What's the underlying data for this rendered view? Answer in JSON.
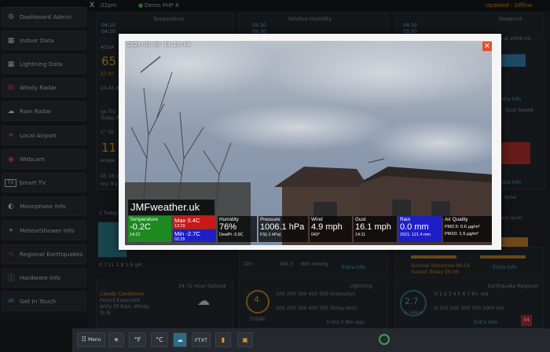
{
  "topbar": {
    "time": ":52pm",
    "station": "Demo PHP 8",
    "updated": "Updated : Offline"
  },
  "sidebar": {
    "items": [
      {
        "label": "Dashboard Admin",
        "icon": "gear-icon"
      },
      {
        "label": "Indoor Data",
        "icon": "indoor-icon"
      },
      {
        "label": "Lightning Data",
        "icon": "lightning-icon"
      },
      {
        "label": "Windy Radar",
        "icon": "windy-icon"
      },
      {
        "label": "Rain Radar",
        "icon": "cloud-icon"
      },
      {
        "label": "Local Airport",
        "icon": "airplane-icon"
      },
      {
        "label": "Webcam",
        "icon": "webcam-icon"
      },
      {
        "label": "Smart TV",
        "icon": "tv-icon"
      },
      {
        "label": "Moonphase Info",
        "icon": "moon-icon"
      },
      {
        "label": "MeteorShower Info",
        "icon": "meteor-icon"
      },
      {
        "label": "Regional Earthquakes",
        "icon": "earthquake-icon"
      },
      {
        "label": "Hardware Info",
        "icon": "info-icon"
      },
      {
        "label": "Get In Touch",
        "icon": "contact-icon"
      }
    ]
  },
  "dashboard": {
    "temperature_title": "Temperature",
    "humidity_title": "Relative Humidity",
    "dewpoint_title": "Dewpoint",
    "temp_rows": [
      "04:10",
      "04:10"
    ],
    "hum_rows": [
      "03:20",
      "09:30"
    ],
    "dew_rows": [
      "04:10",
      "05:50"
    ],
    "dew_note": "m at 2008 mt",
    "gust_title": "Gust Speed",
    "solar_title": "Solar",
    "uv_title": "face (Lux)",
    "extra_info": "Extra Info",
    "big_left": "65",
    "big_left2": "11",
    "side_labels": [
      "ACGA",
      "27.0°",
      "24.65.8",
      "ge Tra",
      "Today R",
      "C° SE",
      "erage",
      "05 16:24",
      "ory Tra",
      "2 Today R"
    ],
    "bottom_left_val": "0.7 11 1.8 1.9 iph",
    "pressure_scale": [
      "720",
      "780.3",
      "800 mmHg"
    ],
    "sunrise": "Sunrise Tomorrow 06:54",
    "sunset": "Sunset Today 06:06",
    "outlook_title": "24-72 Hour Outlook",
    "outlook_text": [
      "Cloudy Conditions.",
      "Period Expected.",
      "bility Of Rain. Windy",
      "To N."
    ],
    "lightning_title": "Lightning",
    "lightning_count": "4",
    "lightning_today": "TODAY",
    "lightning_scale1": "100 200 300 400 500 (Intensity)",
    "lightning_scale2": "100 200 300 400 500 Today (km)",
    "lightning_ago": "3 Hrs 0 Min Ago",
    "eq_title": "Earthquake Regional",
    "eq_mag": "2.7",
    "eq_dist": "5.56km",
    "eq_scale1": "0 1 2 3 4 5 6 7 8+ red",
    "eq_scale2": "0 100 200 300 500 1000 km",
    "eq_day": "34"
  },
  "toolbar": {
    "menu": "Menu",
    "f": "°F",
    "c": "°C",
    "ftxt": "FTXT"
  },
  "webcam": {
    "timestamp": "2021-02-09 14:22:04",
    "brand": "JMFweather.uk",
    "close": "×",
    "boxes": [
      {
        "label": "Temperature",
        "value": "-0.2C",
        "sub": "14:22",
        "color": "#1c8a1f"
      },
      {
        "label": "Max 0.4C",
        "value": "",
        "sub": "13:29",
        "color": "#c91818"
      },
      {
        "label": "Min -2.7C",
        "value": "",
        "sub": "02:25",
        "color": "#1e1ec6"
      },
      {
        "label": "Humidity",
        "value": "76%",
        "sub": "DewPt -3.9C",
        "color": "rgba(0,0,0,0.72)"
      },
      {
        "label": "Pressure",
        "value": "1006.1 hPa",
        "sub": "FS(-1 hPa)",
        "color": "rgba(0,0,0,0.72)"
      },
      {
        "label": "Wind",
        "value": "4.9 mph",
        "sub": "043°",
        "color": "rgba(0,0,0,0.72)"
      },
      {
        "label": "Gust",
        "value": "16.1 mph",
        "sub": "14:11",
        "color": "rgba(0,0,0,0.72)"
      },
      {
        "label": "Rain",
        "value": "0.0 mm",
        "sub": "2021: 121.4 mm",
        "color": "#1e1ec6"
      },
      {
        "label": "Air Quality",
        "value": "",
        "sub": "",
        "color": "rgba(0,0,0,0.72)"
      }
    ],
    "aq_pm25": "PM2.5: 0.6 µg/m³",
    "aq_pm10": "PM10: 1.5 µg/m³"
  }
}
